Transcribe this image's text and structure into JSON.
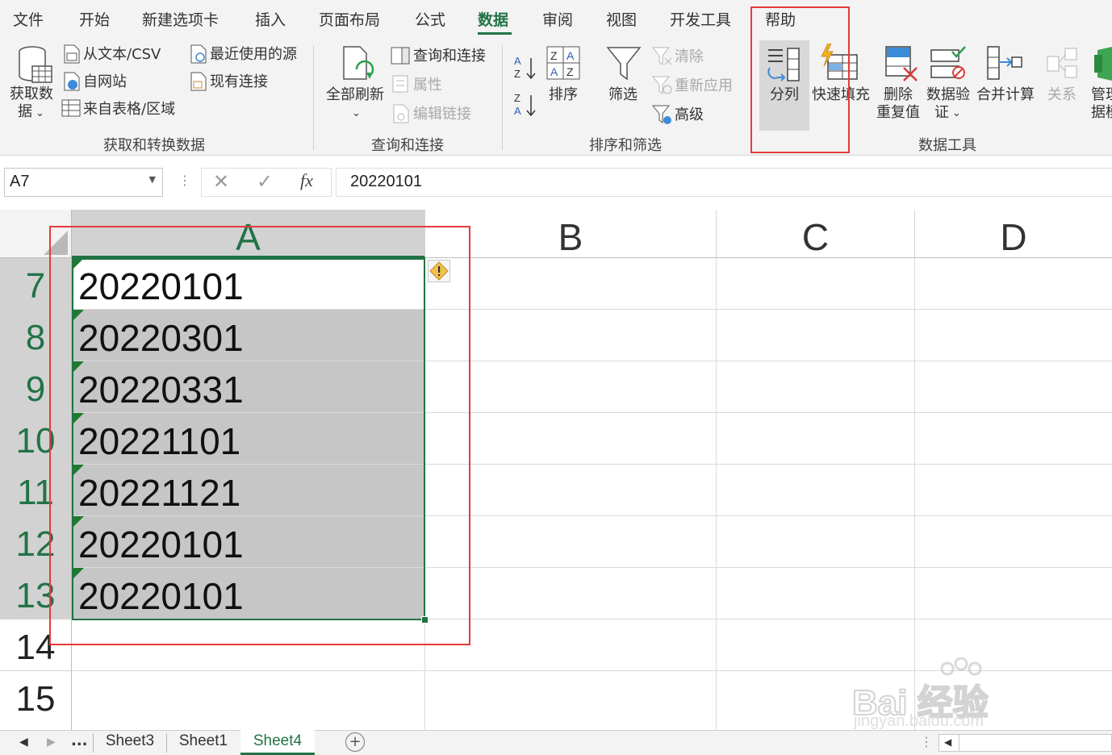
{
  "menu_tabs": [
    "文件",
    "开始",
    "新建选项卡",
    "插入",
    "页面布局",
    "公式",
    "数据",
    "审阅",
    "视图",
    "开发工具",
    "帮助"
  ],
  "active_tab": "数据",
  "ribbon": {
    "get_transform": {
      "group_label": "获取和转换数据",
      "get_data_line1": "获取数",
      "get_data_line2": "据",
      "from_text": "从文本/CSV",
      "from_web": "自网站",
      "from_table": "来自表格/区域",
      "recent_sources": "最近使用的源",
      "existing_connections": "现有连接"
    },
    "queries": {
      "group_label": "查询和连接",
      "refresh_all": "全部刷新",
      "queries_connections": "查询和连接",
      "properties": "属性",
      "edit_links": "编辑链接"
    },
    "sort_filter": {
      "group_label": "排序和筛选",
      "sort": "排序",
      "filter": "筛选",
      "clear": "清除",
      "reapply": "重新应用",
      "advanced": "高级"
    },
    "data_tools": {
      "group_label": "数据工具",
      "text_to_columns": "分列",
      "flash_fill": "快速填充",
      "remove_dup_line1": "删除",
      "remove_dup_line2": "重复值",
      "validation_line1": "数据验",
      "validation_line2": "证",
      "consolidate": "合并计算",
      "relationships": "关系",
      "manage_line1": "管理",
      "manage_line2": "据模"
    }
  },
  "formula_bar": {
    "name_box": "A7",
    "fx": "fx",
    "value": "20220101"
  },
  "columns": [
    "A",
    "B",
    "C",
    "D"
  ],
  "rows": [
    {
      "num": "7",
      "a": "20220101"
    },
    {
      "num": "8",
      "a": "20220301"
    },
    {
      "num": "9",
      "a": "20220331"
    },
    {
      "num": "10",
      "a": "20221101"
    },
    {
      "num": "11",
      "a": "20221121"
    },
    {
      "num": "12",
      "a": "20220101"
    },
    {
      "num": "13",
      "a": "20220101"
    },
    {
      "num": "14",
      "a": ""
    },
    {
      "num": "15",
      "a": ""
    }
  ],
  "sheets": {
    "ellipsis": "...",
    "tabs": [
      "Sheet3",
      "Sheet1",
      "Sheet4"
    ],
    "active": "Sheet4"
  },
  "watermark": {
    "brand": "Bai 经验",
    "url": "jingyan.baidu.com"
  },
  "colors": {
    "accent": "#217346",
    "highlight": "#e53a3a",
    "selection": "#c6c6c6"
  }
}
